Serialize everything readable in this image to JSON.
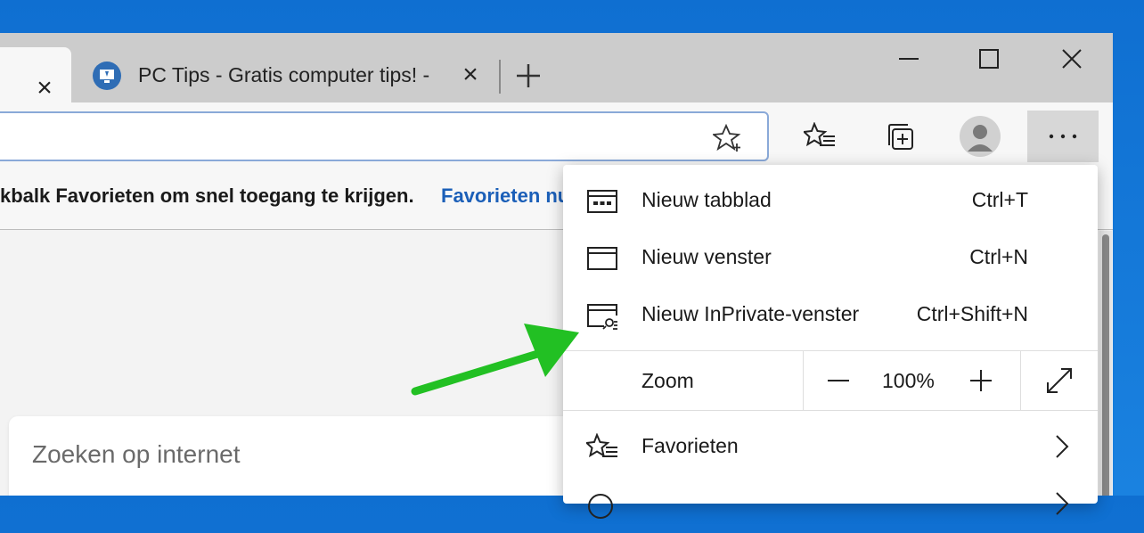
{
  "tabs": [
    {
      "title": "",
      "active": true
    },
    {
      "title": "PC Tips - Gratis computer tips! -",
      "active": false
    }
  ],
  "favorites_bar": {
    "message": "kbalk Favorieten om snel toegang te krijgen.",
    "link": "Favorieten nu"
  },
  "search": {
    "placeholder": "Zoeken op internet"
  },
  "menu": {
    "items": [
      {
        "label": "Nieuw tabblad",
        "shortcut": "Ctrl+T",
        "icon": "new-tab-icon"
      },
      {
        "label": "Nieuw venster",
        "shortcut": "Ctrl+N",
        "icon": "window-icon"
      },
      {
        "label": "Nieuw InPrivate-venster",
        "shortcut": "Ctrl+Shift+N",
        "icon": "inprivate-icon"
      }
    ],
    "zoom": {
      "label": "Zoom",
      "value": "100%",
      "minus": "−",
      "plus": "+"
    },
    "favorites": {
      "label": "Favorieten",
      "icon": "favorites-icon"
    }
  },
  "colors": {
    "accent": "#1b5fb8",
    "annotation_arrow": "#22c023",
    "desktop": "#1a82e0"
  }
}
